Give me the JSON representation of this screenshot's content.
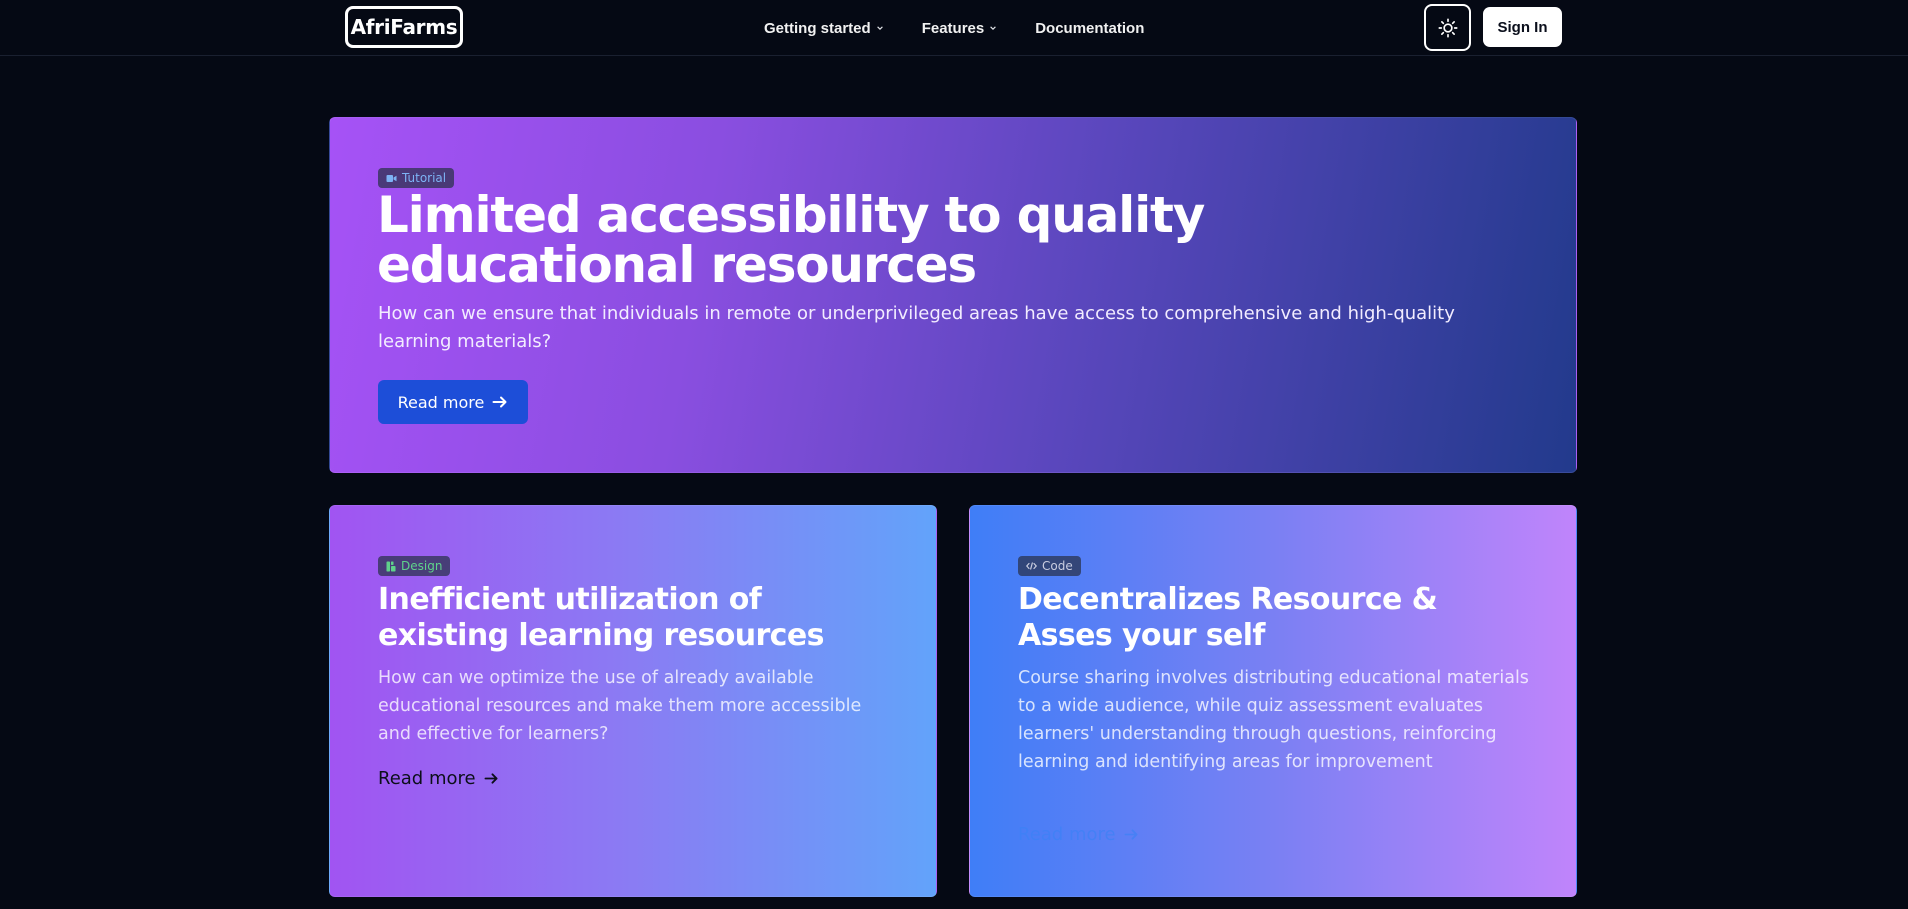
{
  "nav": {
    "logo": "AfriFarms",
    "links": [
      {
        "label": "Getting started",
        "has_dropdown": true
      },
      {
        "label": "Features",
        "has_dropdown": true
      },
      {
        "label": "Documentation",
        "has_dropdown": false
      }
    ],
    "theme_toggle_icon": "sun-icon",
    "sign_in": "Sign In"
  },
  "hero": {
    "badge_icon": "video-icon",
    "badge": "Tutorial",
    "title": "Limited accessibility to quality educational resources",
    "description": "How can we ensure that individuals in remote or underprivileged areas have access to comprehensive and high-quality learning materials?",
    "cta": "Read more",
    "cta_icon": "arrow-right-icon"
  },
  "cards": [
    {
      "badge_icon": "design-icon",
      "badge": "Design",
      "title": "Inefficient utilization of existing learning resources",
      "description": "How can we optimize the use of already available educational resources and make them more accessible and effective for learners?",
      "link": "Read more"
    },
    {
      "badge_icon": "code-icon",
      "badge": "Code",
      "title": "Decentralizes Resource & Asses your self",
      "description": "Course sharing involves distributing educational materials to a wide audience, while quiz assessment evaluates learners' understanding through questions, reinforcing learning and identifying areas for improvement",
      "link": "Read more"
    }
  ],
  "colors": {
    "page_bg": "#050914",
    "primary_button": "#1d4ed8",
    "tutorial_badge_text": "#7db3f5",
    "design_badge_text": "#5fd28b"
  }
}
